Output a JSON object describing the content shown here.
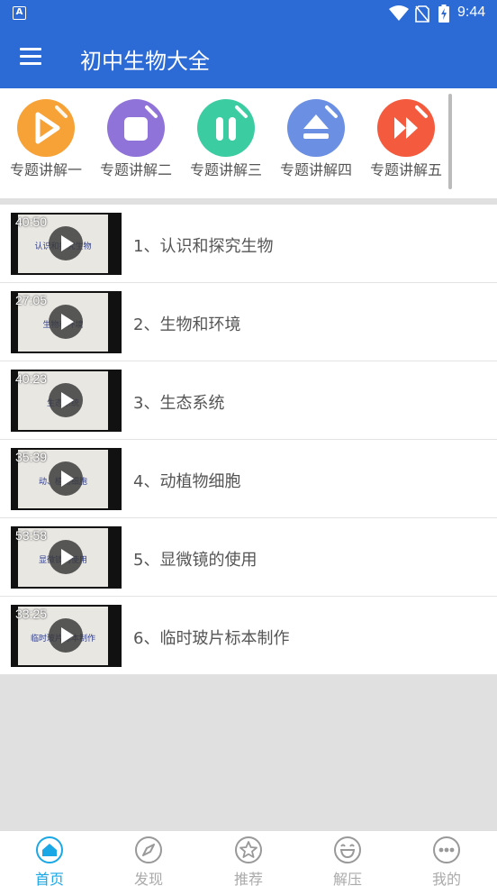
{
  "status_bar": {
    "time": "9:44",
    "app_indicator": "A"
  },
  "app_bar": {
    "title": "初中生物大全",
    "menu_icon": "hamburger-menu-icon"
  },
  "topics": [
    {
      "label": "专题讲解一",
      "color": "#f7a236",
      "icon": "play-icon"
    },
    {
      "label": "专题讲解二",
      "color": "#8f73d8",
      "icon": "stop-icon"
    },
    {
      "label": "专题讲解三",
      "color": "#3ccca2",
      "icon": "pause-icon"
    },
    {
      "label": "专题讲解四",
      "color": "#6b8fe2",
      "icon": "eject-icon"
    },
    {
      "label": "专题讲解五",
      "color": "#f45a3d",
      "icon": "fast-forward-icon"
    }
  ],
  "videos": [
    {
      "duration": "40:50",
      "title": "1、认识和探究生物",
      "thumb_text": "认识和探究生物"
    },
    {
      "duration": "27:05",
      "title": "2、生物和环境",
      "thumb_text": "生物和环境"
    },
    {
      "duration": "40:23",
      "title": "3、生态系统",
      "thumb_text": "生态系统"
    },
    {
      "duration": "35:39",
      "title": "4、动植物细胞",
      "thumb_text": "动、植物细胞"
    },
    {
      "duration": "53:58",
      "title": "5、显微镜的使用",
      "thumb_text": "显微镜的使用"
    },
    {
      "duration": "33:25",
      "title": "6、临时玻片标本制作",
      "thumb_text": "临时玻片标本制作"
    }
  ],
  "bottom_nav": [
    {
      "label": "首页",
      "icon": "home-icon",
      "active": true
    },
    {
      "label": "发现",
      "icon": "compass-icon",
      "active": false
    },
    {
      "label": "推荐",
      "icon": "star-icon",
      "active": false
    },
    {
      "label": "解压",
      "icon": "smile-icon",
      "active": false
    },
    {
      "label": "我的",
      "icon": "more-icon",
      "active": false
    }
  ],
  "colors": {
    "primary": "#2c6ad6",
    "nav_active": "#1aa7e6",
    "nav_inactive": "#aaaaaa"
  }
}
